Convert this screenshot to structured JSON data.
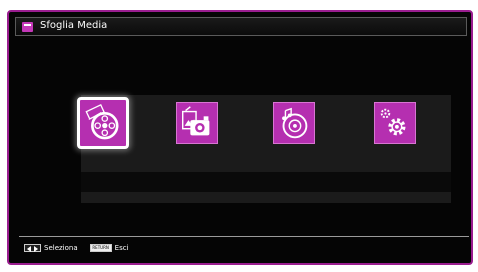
{
  "header": {
    "title": "Sfoglia Media",
    "icon": "media-browser-icon"
  },
  "media_items": [
    {
      "icon": "film-reel-icon",
      "selected": true
    },
    {
      "icon": "photo-camera-icon",
      "selected": false
    },
    {
      "icon": "music-disc-icon",
      "selected": false
    },
    {
      "icon": "settings-gear-icon",
      "selected": false
    }
  ],
  "footer": {
    "select_key_icon": "left-right-arrows-key-icon",
    "select_label": "Seleziona",
    "return_key_label": "RETURN",
    "exit_label": "Esci"
  },
  "colors": {
    "accent": "#b52fb0",
    "frame": "#9a1d8f",
    "background": "#050505"
  }
}
